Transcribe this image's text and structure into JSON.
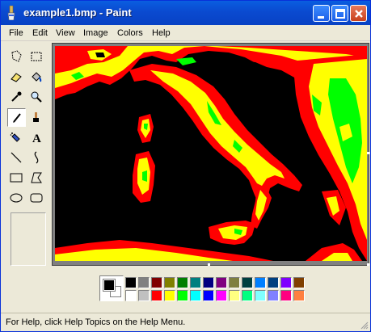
{
  "window": {
    "title": "example1.bmp - Paint"
  },
  "menu": [
    "File",
    "Edit",
    "View",
    "Image",
    "Colors",
    "Help"
  ],
  "tools": [
    "free-form-select",
    "select",
    "eraser",
    "fill-with-color",
    "pick-color",
    "magnifier",
    "pencil",
    "brush",
    "airbrush",
    "text",
    "line",
    "curve",
    "rectangle",
    "polygon",
    "ellipse",
    "rounded-rectangle"
  ],
  "palette": {
    "foreground": "#000000",
    "background": "#ffffff",
    "row1": [
      "#000000",
      "#808080",
      "#800000",
      "#808000",
      "#008000",
      "#008080",
      "#000080",
      "#800080",
      "#808040",
      "#004040",
      "#0080ff",
      "#004080",
      "#8000ff",
      "#804000"
    ],
    "row2": [
      "#ffffff",
      "#c0c0c0",
      "#ff0000",
      "#ffff00",
      "#00ff00",
      "#00ffff",
      "#0000ff",
      "#ff00ff",
      "#ffff80",
      "#00ff80",
      "#80ffff",
      "#8080ff",
      "#ff0080",
      "#ff8040"
    ]
  },
  "map_colors": {
    "sea": "#000000",
    "low": "#ff0000",
    "mid": "#ffff00",
    "high": "#00ff00"
  },
  "status": "For Help, click Help Topics on the Help Menu."
}
